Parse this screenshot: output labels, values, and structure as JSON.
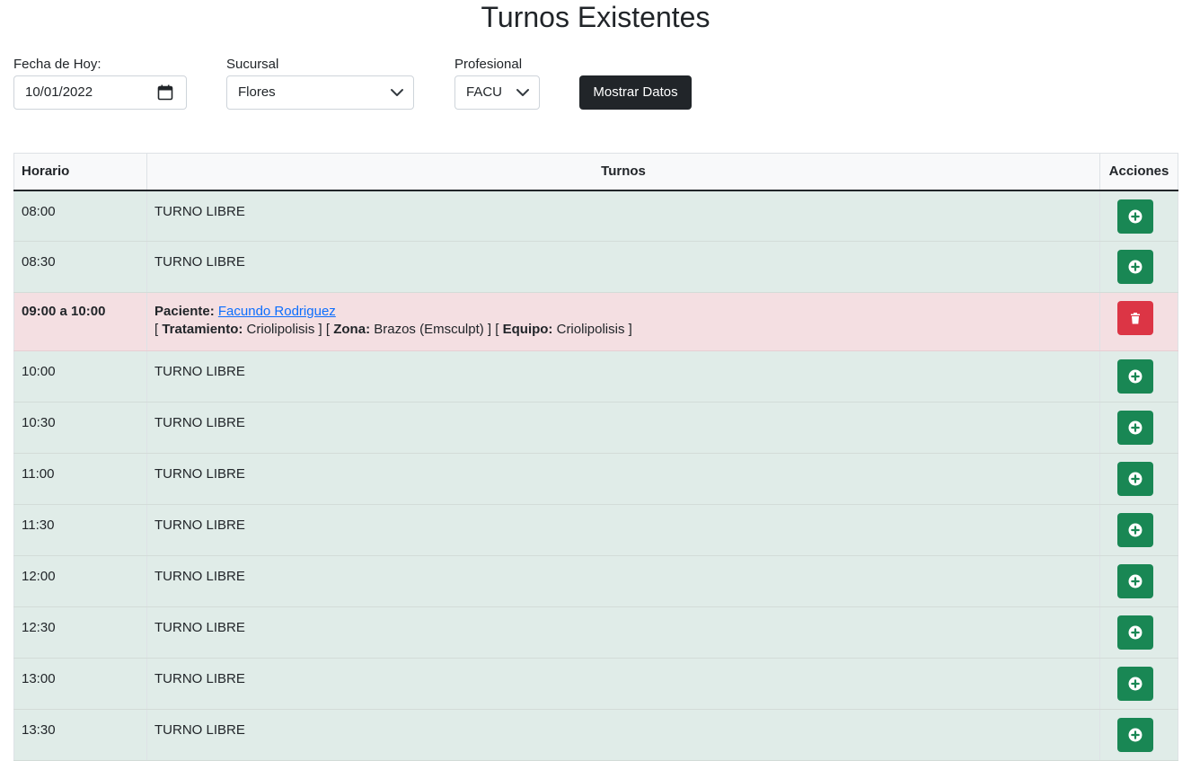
{
  "header": {
    "title": "Turnos Existentes"
  },
  "filters": {
    "date": {
      "label": "Fecha de Hoy:",
      "value": "10/01/2022"
    },
    "branch": {
      "label": "Sucursal",
      "value": "Flores"
    },
    "professional": {
      "label": "Profesional",
      "value": "FACU"
    },
    "submit_label": "Mostrar Datos"
  },
  "table": {
    "headers": {
      "time": "Horario",
      "slots": "Turnos",
      "actions": "Acciones"
    },
    "free_label": "TURNO LIBRE",
    "rows": [
      {
        "time": "08:00"
      },
      {
        "time": "08:30"
      },
      {
        "time": "09:00 a 10:00",
        "patient_label": "Paciente:",
        "patient_name": "Facundo Rodriguez",
        "treatment_label": "Tratamiento:",
        "treatment_value": "Criolipolisis",
        "zone_label": "Zona:",
        "zone_value": "Brazos (Emsculpt)",
        "equipment_label": "Equipo:",
        "equipment_value": "Criolipolisis"
      },
      {
        "time": "10:00"
      },
      {
        "time": "10:30"
      },
      {
        "time": "11:00"
      },
      {
        "time": "11:30"
      },
      {
        "time": "12:00"
      },
      {
        "time": "12:30"
      },
      {
        "time": "13:00"
      },
      {
        "time": "13:30"
      }
    ]
  },
  "colors": {
    "free_row": "#e0ece8",
    "busy_row": "#f4dfe2",
    "add_button": "#198754",
    "delete_button": "#dc3545",
    "dark_button": "#212529"
  },
  "icons": {
    "add": "plus-circle-icon",
    "delete": "trash-icon"
  }
}
